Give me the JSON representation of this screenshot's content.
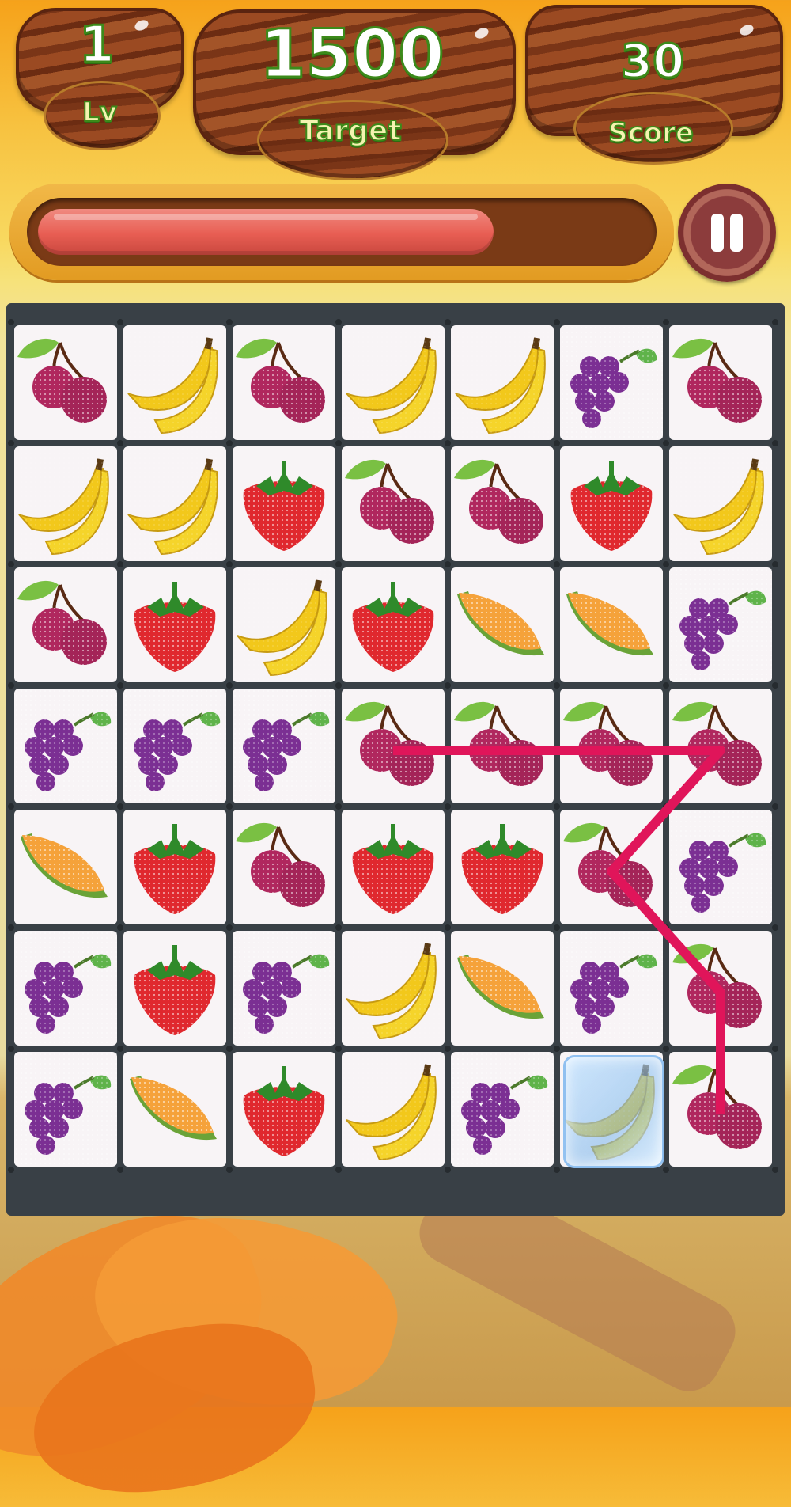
{
  "hud": {
    "level_value": "1",
    "level_label": "Lv",
    "target_value": "1500",
    "target_label": "Target",
    "score_value": "30",
    "score_label": "Score"
  },
  "timer": {
    "remaining_fraction": 0.75
  },
  "pause_icon": "pause-icon",
  "colors": {
    "timer_fill": "#e85e53",
    "match_line": "#e0155a",
    "board": "#394046",
    "hud_text_outline": "#3c8a1a"
  },
  "board": {
    "columns": 7,
    "rows": 7,
    "tiles": [
      [
        "cherry",
        "banana",
        "cherry",
        "banana",
        "banana",
        "grape",
        "cherry"
      ],
      [
        "banana",
        "banana",
        "strawberry",
        "cherry",
        "cherry",
        "strawberry",
        "banana"
      ],
      [
        "cherry",
        "strawberry",
        "banana",
        "strawberry",
        "melon",
        "melon",
        "grape"
      ],
      [
        "grape",
        "grape",
        "grape",
        "cherry",
        "cherry",
        "cherry",
        "cherry"
      ],
      [
        "melon",
        "strawberry",
        "cherry",
        "strawberry",
        "strawberry",
        "cherry",
        "grape"
      ],
      [
        "grape",
        "strawberry",
        "grape",
        "banana",
        "melon",
        "grape",
        "cherry"
      ],
      [
        "grape",
        "melon",
        "strawberry",
        "banana",
        "grape",
        "banana",
        "cherry"
      ]
    ],
    "frozen_tiles": [
      [
        6,
        5
      ]
    ],
    "match_path": [
      [
        3,
        3
      ],
      [
        3,
        4
      ],
      [
        3,
        5
      ],
      [
        3,
        6
      ],
      [
        4,
        5
      ],
      [
        5,
        6
      ],
      [
        6,
        6
      ]
    ]
  }
}
